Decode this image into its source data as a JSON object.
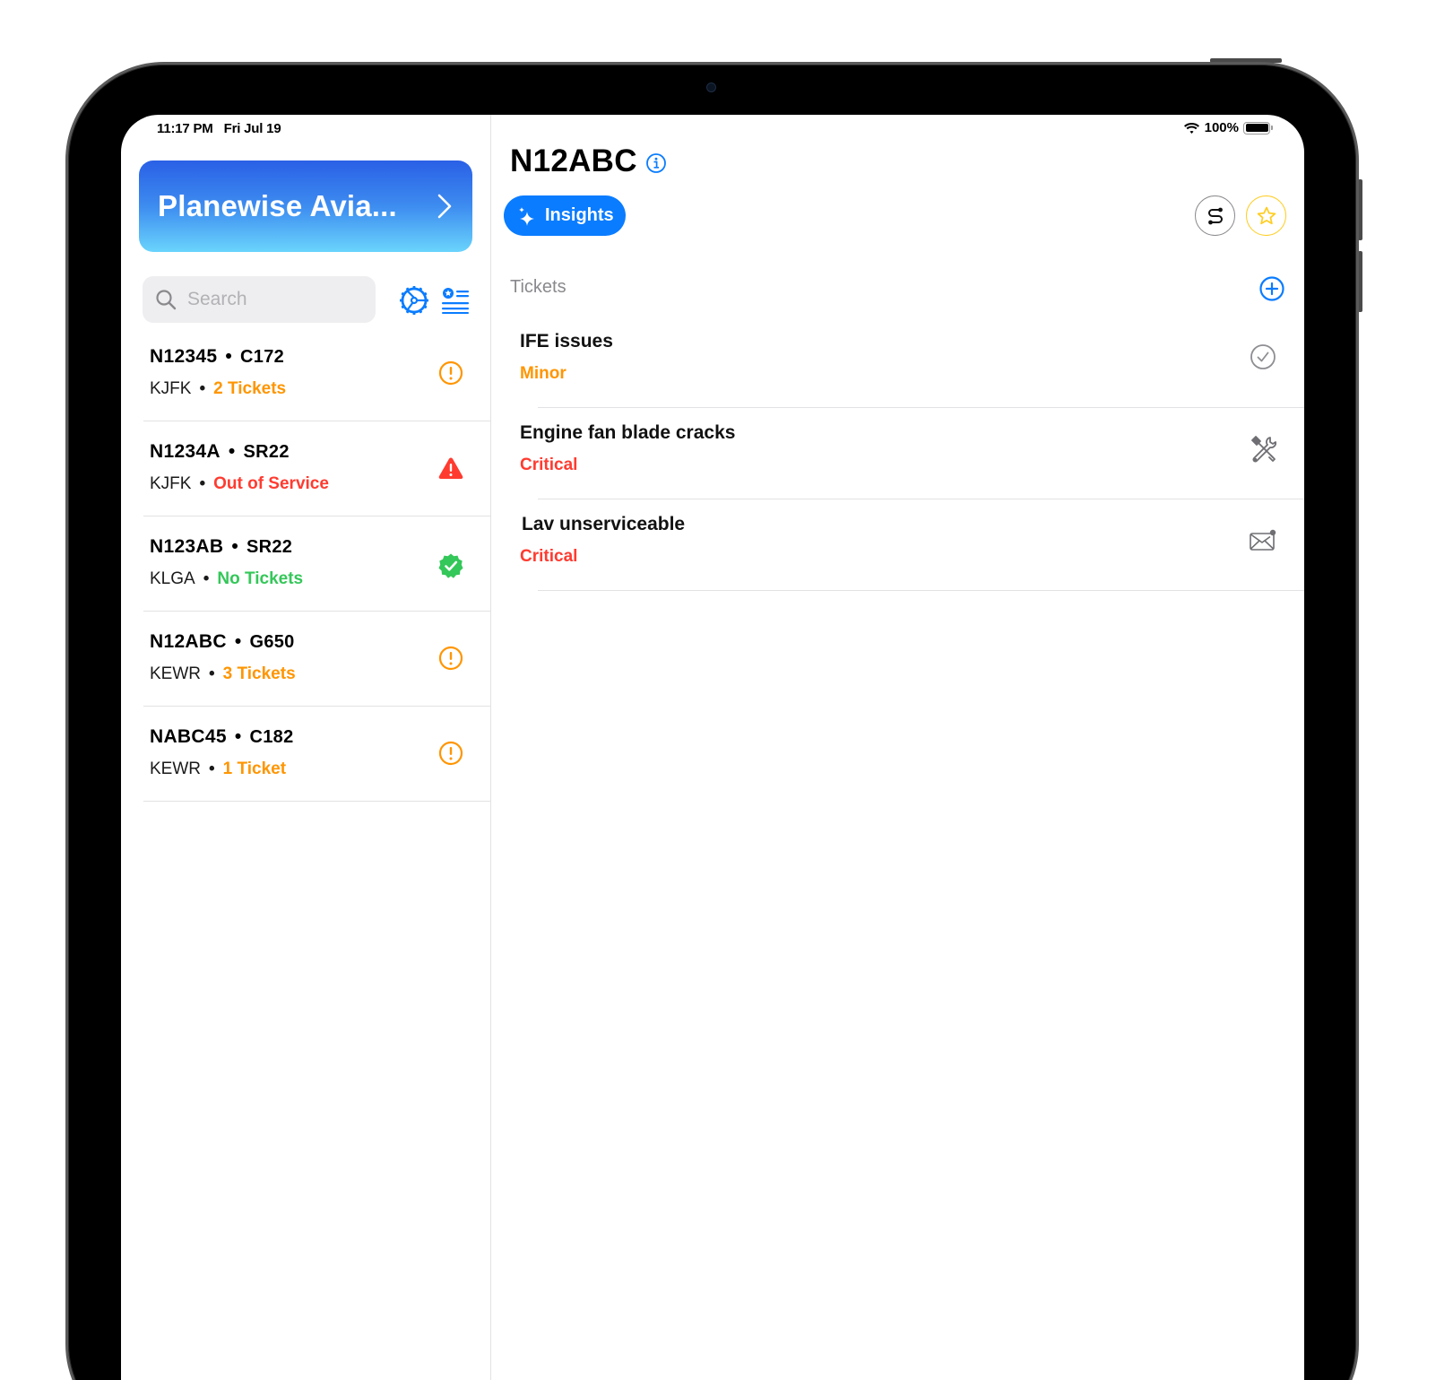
{
  "status_bar": {
    "time": "11:17 PM",
    "date": "Fri Jul 19",
    "battery": "100%",
    "battery_level": 1.0,
    "wifi_icon": "wifi-icon"
  },
  "sidebar": {
    "org_name": "Planewise Avia...",
    "search": {
      "placeholder": "Search",
      "value": ""
    },
    "toolbar_icons": [
      "gear-icon",
      "filter-list-icon"
    ],
    "aircraft": [
      {
        "tail": "N12345",
        "model": "C172",
        "airport": "KJFK",
        "status": "2 Tickets",
        "status_color": "#ff9500",
        "icon": "exclamation-circle-icon"
      },
      {
        "tail": "N1234A",
        "model": "SR22",
        "airport": "KJFK",
        "status": "Out of Service",
        "status_color": "#ff3b30",
        "icon": "warning-triangle-icon"
      },
      {
        "tail": "N123AB",
        "model": "SR22",
        "airport": "KLGA",
        "status": "No Tickets",
        "status_color": "#34c759",
        "icon": "checkmark-seal-icon"
      },
      {
        "tail": "N12ABC",
        "model": "G650",
        "airport": "KEWR",
        "status": "3 Tickets",
        "status_color": "#ff9500",
        "icon": "exclamation-circle-icon"
      },
      {
        "tail": "NABC45",
        "model": "C182",
        "airport": "KEWR",
        "status": "1 Ticket",
        "status_color": "#ff9500",
        "icon": "exclamation-circle-icon"
      }
    ],
    "separator": "•"
  },
  "detail": {
    "title": "N12ABC",
    "insights_label": "Insights",
    "tickets_header": "Tickets",
    "tickets": [
      {
        "title": "IFE issues",
        "severity": "Minor",
        "severity_color": "#ff9500",
        "icon": "checkmark-circle-icon"
      },
      {
        "title": "Engine fan blade cracks",
        "severity": "Critical",
        "severity_color": "#ff3b30",
        "icon": "wrench-screwdriver-icon"
      },
      {
        "title": "Lav unserviceable",
        "severity": "Critical",
        "severity_color": "#ff3b30",
        "icon": "envelope-badge-icon"
      }
    ]
  },
  "colors": {
    "accent": "#0a7cff",
    "warning": "#ff9500",
    "critical": "#ff3b30",
    "ok": "#34c759",
    "favorite": "#ffcc1f"
  }
}
